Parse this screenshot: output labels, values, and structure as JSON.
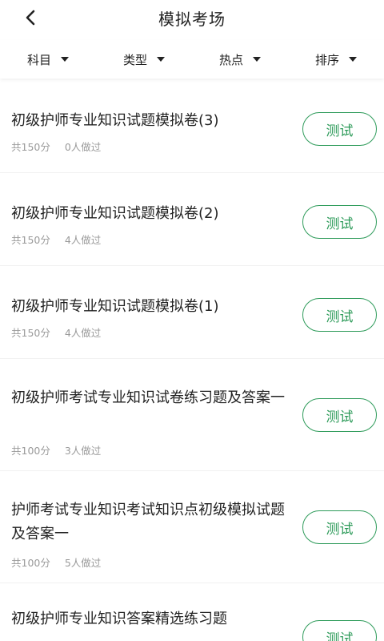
{
  "header": {
    "back_icon": "chevron-left-icon",
    "title": "模拟考场"
  },
  "filters": [
    {
      "label": "科目",
      "icon": "caret-down-icon"
    },
    {
      "label": "类型",
      "icon": "caret-down-icon"
    },
    {
      "label": "热点",
      "icon": "caret-down-icon"
    },
    {
      "label": "排序",
      "icon": "caret-down-icon"
    }
  ],
  "colors": {
    "accent": "#2e9b5a",
    "meta_text": "#9a9a9a",
    "title_text": "#222222"
  },
  "exams": [
    {
      "title": "初级护师专业知识试题模拟卷(3)",
      "score": "共150分",
      "participants": "0人做过",
      "button": "测试"
    },
    {
      "title": "初级护师专业知识试题模拟卷(2)",
      "score": "共150分",
      "participants": "4人做过",
      "button": "测试"
    },
    {
      "title": "初级护师专业知识试题模拟卷(1)",
      "score": "共150分",
      "participants": "4人做过",
      "button": "测试"
    },
    {
      "title": "初级护师考试专业知识试卷练习题及答案一",
      "score": "共100分",
      "participants": "3人做过",
      "button": "测试"
    },
    {
      "title": "护师考试专业知识考试知识点初级模拟试题及答案一",
      "score": "共100分",
      "participants": "5人做过",
      "button": "测试"
    },
    {
      "title": "初级护师专业知识答案精选练习题",
      "button": "测试"
    }
  ]
}
